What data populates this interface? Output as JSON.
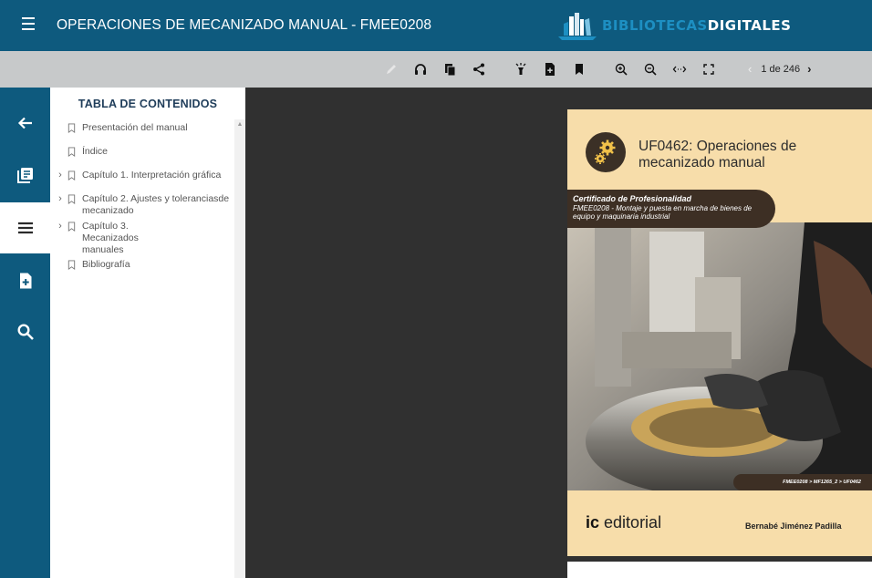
{
  "header": {
    "title": "OPERACIONES DE MECANIZADO MANUAL - FMEE0208",
    "brand_part1": "BIBLIOTECAS",
    "brand_part2": "DIGITALES"
  },
  "toolbar": {
    "icons": [
      "pencil-icon",
      "headphones-icon",
      "copy-icon",
      "share-icon",
      "highlighter-icon",
      "add-document-icon",
      "bookmark-icon",
      "zoom-in-icon",
      "zoom-out-icon",
      "fit-width-icon",
      "fullscreen-icon"
    ],
    "pager": {
      "label": "1 de 246",
      "prev": "‹",
      "next": "›"
    }
  },
  "rail": {
    "items": [
      "back-arrow-icon",
      "library-icon",
      "toc-list-icon",
      "add-note-icon",
      "search-icon"
    ],
    "active": "toc-list-icon"
  },
  "toc": {
    "title": "TABLA DE CONTENIDOS",
    "items": [
      {
        "label": "Presentación del manual",
        "expandable": false
      },
      {
        "label": "Índice",
        "expandable": false
      },
      {
        "label": "Capítulo 1. Interpretación gráfica",
        "expandable": true
      },
      {
        "label": "Capítulo 2. Ajustes y toleranciasde mecanizado",
        "expandable": true
      },
      {
        "label": "Capítulo 3. Mecanizados manuales",
        "expandable": true
      },
      {
        "label": "Bibliografía",
        "expandable": false
      }
    ]
  },
  "cover": {
    "title": "UF0462: Operaciones de mecanizado manual",
    "cert_title": "Certificado de Profesionalidad",
    "cert_subtitle": "FMEE0208 - Montaje y puesta en marcha de bienes de equipo y maquinaria industrial",
    "code": "FMEE0208 > MF1265_2 > UF0462",
    "publisher_ic": "ic",
    "publisher_name": "editorial",
    "author": "Bernabé Jiménez Padilla"
  },
  "colors": {
    "header": "#0e5a7e",
    "toolbar": "#c7c9ca",
    "viewer": "#303030",
    "cover_bg": "#f7ddaa",
    "band": "#3d2f24"
  }
}
